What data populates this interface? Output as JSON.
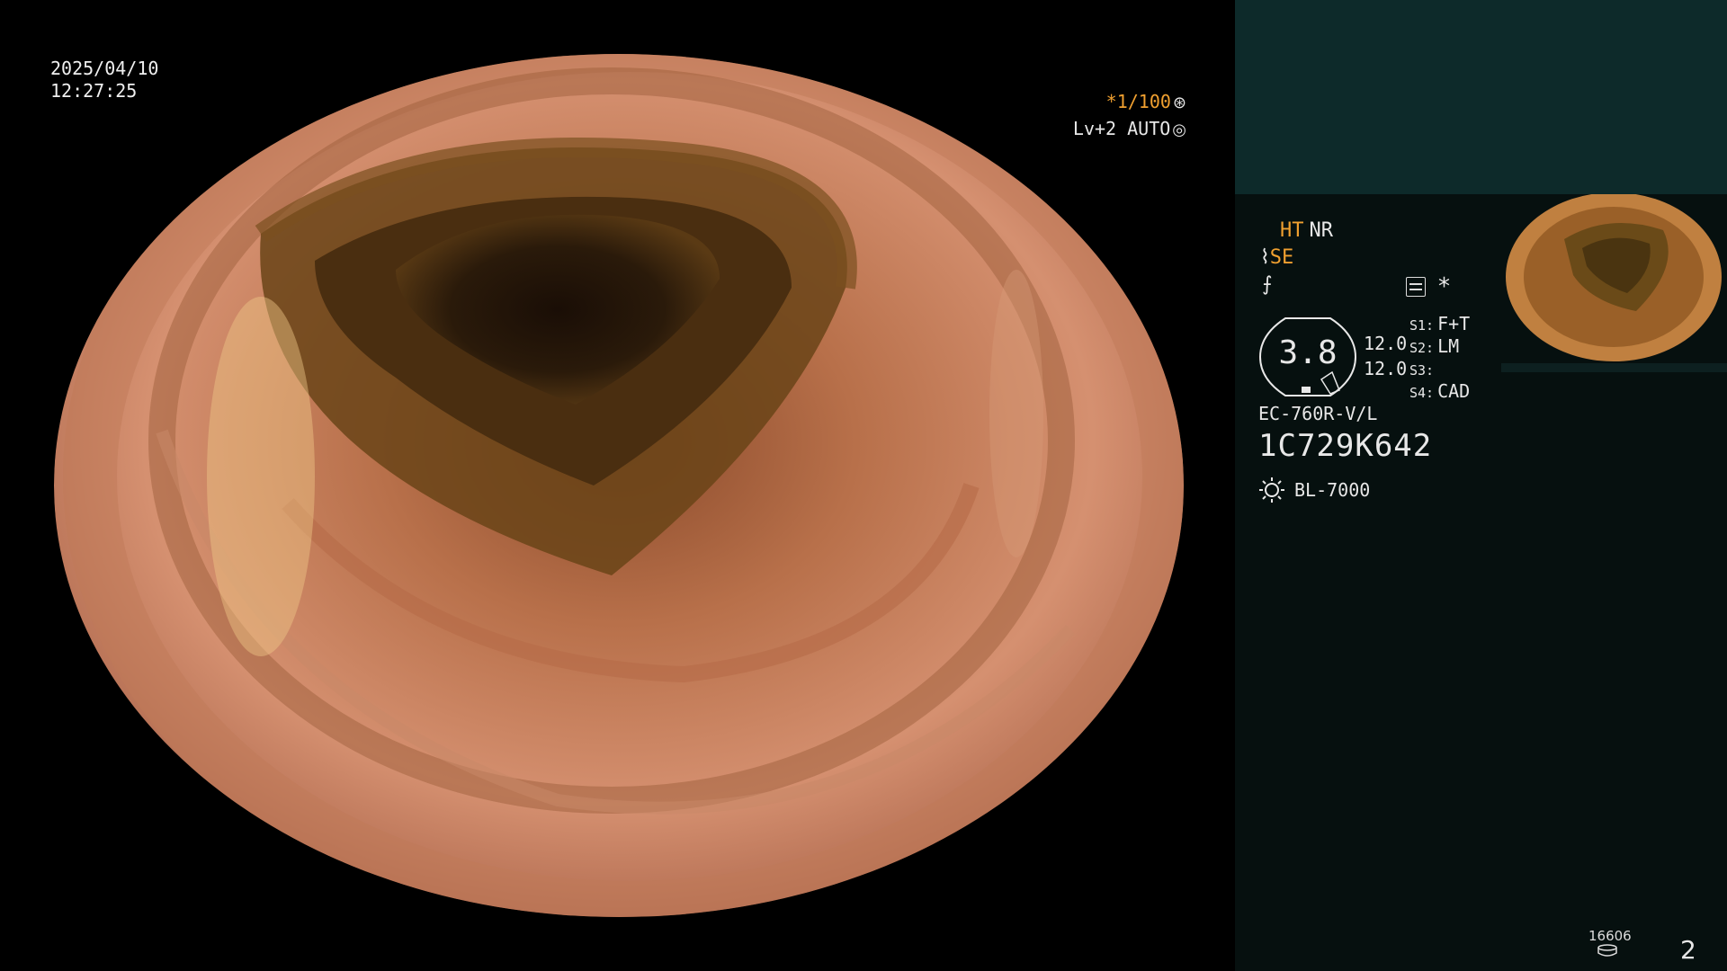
{
  "osd": {
    "date": "2025/04/10",
    "time": "12:27:25",
    "shutter": "*1/100",
    "shutter_icon": "aperture-icon",
    "level": "Lv+2 AUTO",
    "level_icon": "auto-iris-icon"
  },
  "panel": {
    "mode_ht": "HT",
    "mode_nr": "NR",
    "mode_se": "SE",
    "se_icon": "structure-enhance-icon",
    "freeze_icon": "freeze-icon",
    "setting_icon": "settings-list-icon",
    "asterisk": "*",
    "gauge_value": "3.8",
    "gauge_a": "12.0",
    "gauge_b": "12.0",
    "s1_key": "S1:",
    "s1_val": "F+T",
    "s2_key": "S2:",
    "s2_val": "LM",
    "s3_key": "S3:",
    "s3_val": "",
    "s4_key": "S4:",
    "s4_val": "CAD",
    "scope_model": "EC-760R-V/L",
    "scope_serial": "1C729K642",
    "light_source": "BL-7000",
    "light_icon": "light-source-icon"
  },
  "status": {
    "counter": "16606",
    "storage_icon": "storage-icon",
    "page": "2"
  },
  "colors": {
    "highlight": "#f0a030",
    "panel_bg": "#06100f",
    "panel_top_bg": "#0d2a2a"
  }
}
